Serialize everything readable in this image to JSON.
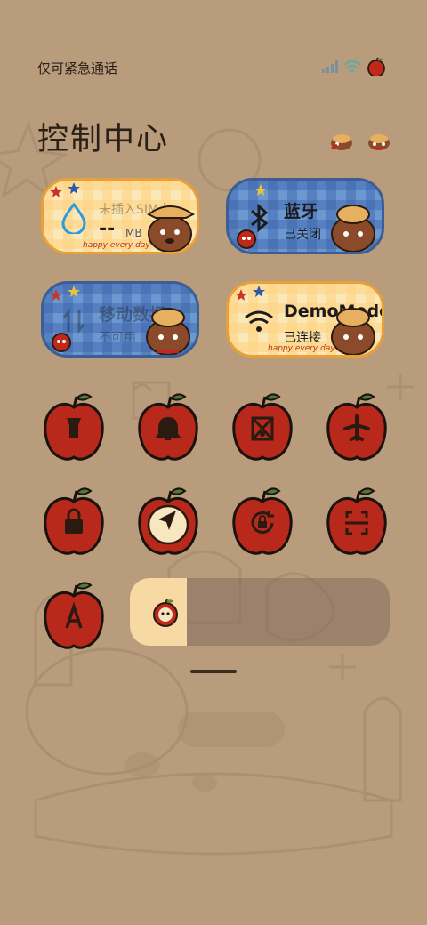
{
  "status_bar": {
    "carrier_text": "仅可紧急通话"
  },
  "page_title": "控制中心",
  "cards": {
    "data_usage": {
      "label": "未插入SIM卡",
      "value": "--",
      "unit": "MB"
    },
    "bluetooth": {
      "label": "蓝牙",
      "status": "已关闭"
    },
    "mobile_data": {
      "label": "移动数据",
      "status": "不可用"
    },
    "wifi": {
      "label": "DemoMode",
      "status": "已连接"
    },
    "sticker_text": "happy every day"
  },
  "toggles": [
    {
      "name": "flashlight",
      "active": false
    },
    {
      "name": "ringer",
      "active": false
    },
    {
      "name": "screen-cast",
      "active": false
    },
    {
      "name": "airplane-mode",
      "active": false
    },
    {
      "name": "screen-lock",
      "active": false
    },
    {
      "name": "location",
      "active": true
    },
    {
      "name": "rotation-lock",
      "active": false
    },
    {
      "name": "scanner",
      "active": false
    },
    {
      "name": "auto-brightness",
      "active": false
    }
  ],
  "brightness_level": 0.22,
  "colors": {
    "background": "#b89c7c",
    "apple_red": "#b8291c",
    "card_yellow": "#fbe8b8",
    "card_blue": "#6c98d2",
    "active_fill": "#f7e6c0"
  }
}
